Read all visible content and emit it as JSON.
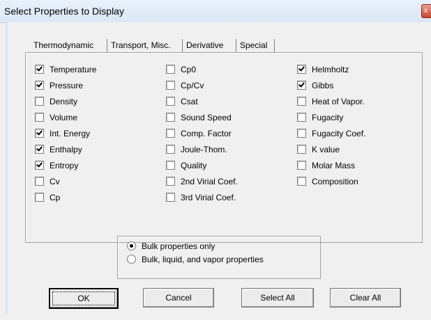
{
  "window": {
    "title": "Select Properties to Display",
    "close_glyph": "x"
  },
  "tabs": [
    {
      "label": "Thermodynamic",
      "active": true
    },
    {
      "label": "Transport, Misc.",
      "active": false
    },
    {
      "label": "Derivative",
      "active": false
    },
    {
      "label": "Special",
      "active": false
    }
  ],
  "columns": {
    "col1": [
      {
        "label": "Temperature",
        "checked": true
      },
      {
        "label": "Pressure",
        "checked": true
      },
      {
        "label": "Density",
        "checked": false
      },
      {
        "label": "Volume",
        "checked": false
      },
      {
        "label": "Int. Energy",
        "checked": true
      },
      {
        "label": "Enthalpy",
        "checked": true
      },
      {
        "label": "Entropy",
        "checked": true
      },
      {
        "label": "Cv",
        "checked": false
      },
      {
        "label": "Cp",
        "checked": false
      }
    ],
    "col2": [
      {
        "label": "Cp0",
        "checked": false
      },
      {
        "label": "Cp/Cv",
        "checked": false
      },
      {
        "label": "Csat",
        "checked": false
      },
      {
        "label": "Sound Speed",
        "checked": false
      },
      {
        "label": "Comp. Factor",
        "checked": false
      },
      {
        "label": "Joule-Thom.",
        "checked": false
      },
      {
        "label": "Quality",
        "checked": false
      },
      {
        "label": "2nd Virial Coef.",
        "checked": false
      },
      {
        "label": "3rd Virial Coef.",
        "checked": false
      }
    ],
    "col3": [
      {
        "label": "Helmholtz",
        "checked": true
      },
      {
        "label": "Gibbs",
        "checked": true
      },
      {
        "label": "Heat of Vapor.",
        "checked": false
      },
      {
        "label": "Fugacity",
        "checked": false
      },
      {
        "label": "Fugacity Coef.",
        "checked": false
      },
      {
        "label": "K value",
        "checked": false
      },
      {
        "label": "Molar Mass",
        "checked": false
      },
      {
        "label": "Composition",
        "checked": false
      }
    ]
  },
  "phase": {
    "options": [
      {
        "label": "Bulk properties only",
        "checked": true
      },
      {
        "label": "Bulk, liquid, and vapor properties",
        "checked": false
      }
    ]
  },
  "buttons": {
    "ok": "OK",
    "cancel": "Cancel",
    "select_all": "Select All",
    "clear_all": "Clear All"
  }
}
